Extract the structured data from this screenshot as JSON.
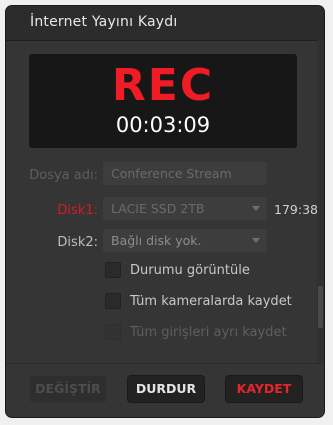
{
  "dialog": {
    "title": "İnternet Yayını Kaydı"
  },
  "recording": {
    "label": "REC",
    "timer": "00:03:09",
    "color": "#ef1c25"
  },
  "filename": {
    "label": "Dosya adı:",
    "value": "Conference Stream"
  },
  "disk1": {
    "label": "Disk1:",
    "selected": "LACIE SSD 2TB",
    "remaining": "179:38"
  },
  "disk2": {
    "label": "Disk2:",
    "selected": "Bağlı disk yok."
  },
  "options": [
    {
      "label": "Durumu görüntüle",
      "checked": false,
      "enabled": true
    },
    {
      "label": "Tüm kameralarda kaydet",
      "checked": false,
      "enabled": true
    },
    {
      "label": "Tüm girişleri ayrı kaydet",
      "checked": false,
      "enabled": false
    }
  ],
  "buttons": {
    "change": "DEĞİŞTİR",
    "stop": "DURDUR",
    "save": "KAYDET"
  },
  "icons": {
    "dropdown": "chevron-down-icon"
  }
}
